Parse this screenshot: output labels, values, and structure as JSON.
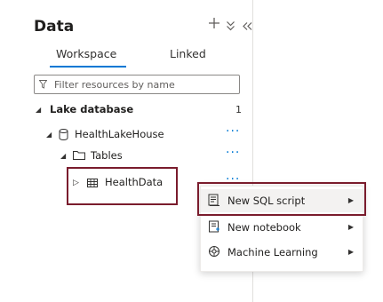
{
  "panel": {
    "title": "Data",
    "add_icon": "plus-icon",
    "collapse_icon": "chevron-double-down-icon",
    "hide_icon": "chevron-double-left-icon",
    "tabs": [
      {
        "label": "Workspace",
        "selected": true
      },
      {
        "label": "Linked",
        "selected": false
      }
    ],
    "filter": {
      "placeholder": "Filter resources by name",
      "value": ""
    }
  },
  "tree": {
    "section": {
      "label": "Lake database",
      "count": "1"
    },
    "database": {
      "label": "HealthLakeHouse",
      "icon": "database-icon",
      "more": "···"
    },
    "folder": {
      "label": "Tables",
      "icon": "folder-icon",
      "more": "···"
    },
    "table": {
      "label": "HealthData",
      "icon": "table-icon",
      "more": "···"
    }
  },
  "context_menu": {
    "items": [
      {
        "label": "New SQL script",
        "icon": "sql-script-icon",
        "has_submenu": true
      },
      {
        "label": "New notebook",
        "icon": "notebook-icon",
        "has_submenu": true
      },
      {
        "label": "Machine Learning",
        "icon": "machine-learning-icon",
        "has_submenu": true
      }
    ]
  },
  "colors": {
    "accent": "#0078d4",
    "highlight_border": "#7a1c2d"
  }
}
